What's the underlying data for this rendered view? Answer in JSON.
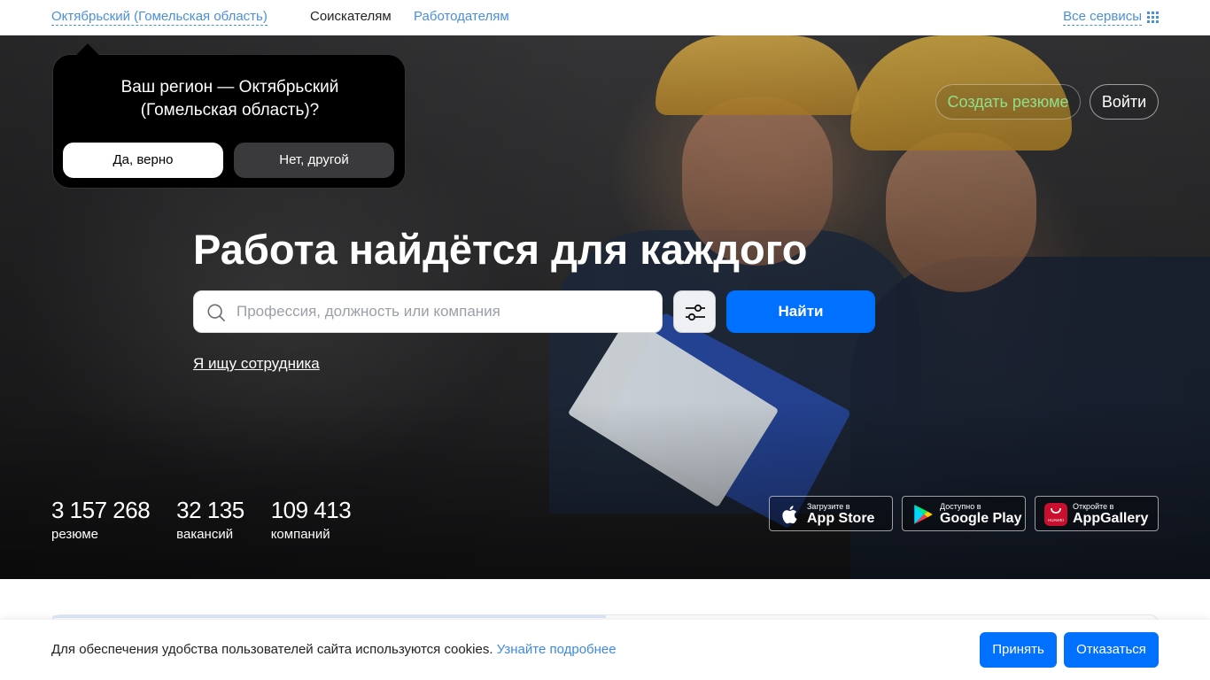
{
  "topbar": {
    "region": "Октябрьский (Гомельская область)",
    "nav_applicants": "Соискателям",
    "nav_employers": "Работодателям",
    "all_services": "Все сервисы",
    "all_services_icon": "grid-icon"
  },
  "region_popup": {
    "question": "Ваш регион — Октябрьский (Гомельская область)?",
    "yes_label": "Да, верно",
    "no_label": "Нет, другой"
  },
  "header_actions": {
    "create_resume": "Создать резюме",
    "login": "Войти"
  },
  "hero": {
    "headline": "Работа найдётся для каждого",
    "search_placeholder": "Профессия, должность или компания",
    "search_value": "",
    "search_icon": "search-icon",
    "filter_icon": "sliders-icon",
    "find_label": "Найти",
    "employer_link": "Я ищу сотрудника"
  },
  "stats": [
    {
      "number": "3 157 268",
      "label": "резюме"
    },
    {
      "number": "32 135",
      "label": "вакансий"
    },
    {
      "number": "109 413",
      "label": "компаний"
    }
  ],
  "stores": {
    "appstore_small": "Загрузите в",
    "appstore_big": "App Store",
    "gplay_small": "Доступно в",
    "gplay_big": "Google Play",
    "gallery_small": "Откройте в",
    "gallery_big": "AppGallery",
    "huawei_text": "HUAWEI"
  },
  "cookie": {
    "text": "Для обеспечения удобства пользователей сайта используются cookies.",
    "more_link": "Узнайте подробнее",
    "accept": "Принять",
    "decline": "Отказаться"
  },
  "colors": {
    "accent": "#0070ff",
    "link": "#4a90d9",
    "resume_green": "#8ee08e"
  }
}
